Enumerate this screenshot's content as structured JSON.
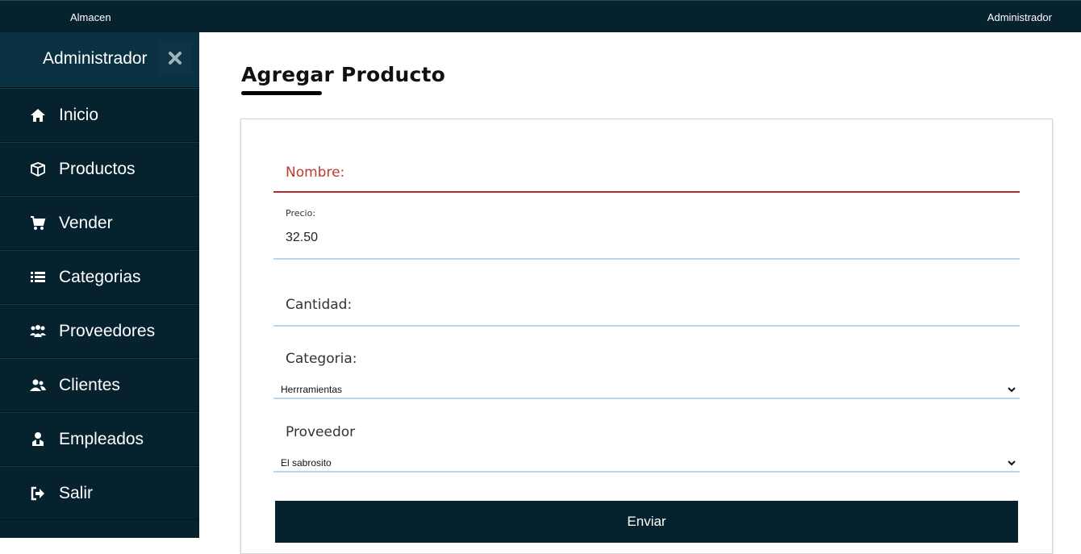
{
  "topbar": {
    "brand": "Almacen",
    "user": "Administrador"
  },
  "sidebar": {
    "title": "Administrador",
    "items": [
      {
        "label": "Inicio",
        "icon": "home-icon"
      },
      {
        "label": "Productos",
        "icon": "box-icon"
      },
      {
        "label": "Vender",
        "icon": "cart-icon"
      },
      {
        "label": "Categorias",
        "icon": "list-icon"
      },
      {
        "label": "Proveedores",
        "icon": "users-icon"
      },
      {
        "label": "Clientes",
        "icon": "user-group-icon"
      },
      {
        "label": "Empleados",
        "icon": "employee-icon"
      },
      {
        "label": "Salir",
        "icon": "logout-icon"
      }
    ]
  },
  "main": {
    "title": "Agregar Producto",
    "form": {
      "nombre_label": "Nombre:",
      "precio_label": "Precio:",
      "precio_value": "32.50",
      "cantidad_label": "Cantidad:",
      "categoria_label": "Categoria:",
      "categoria_value": "Herrramientas",
      "proveedor_label": "Proveedor",
      "proveedor_value": "El sabrosito",
      "submit_label": "Enviar"
    }
  },
  "colors": {
    "navy": "#06222f",
    "error_red": "#b82c2c",
    "input_line": "#bcd7ee"
  }
}
